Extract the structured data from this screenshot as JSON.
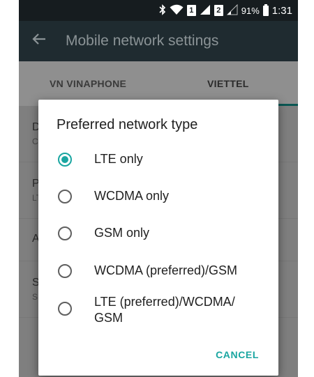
{
  "status_bar": {
    "sim1": "1",
    "sim2": "2",
    "battery": "91%",
    "time": "1:31"
  },
  "app_bar": {
    "title": "Mobile network settings"
  },
  "tabs": [
    {
      "label": "VN VINAPHONE"
    },
    {
      "label": "VIETTEL"
    }
  ],
  "background_list": [
    {
      "initial": "D",
      "sub": "C"
    },
    {
      "initial": "P",
      "sub": "LT"
    },
    {
      "initial": "A",
      "sub": ""
    },
    {
      "initial": "S",
      "sub": "S"
    }
  ],
  "dialog": {
    "title": "Preferred network type",
    "options": [
      {
        "label": "LTE only",
        "selected": true
      },
      {
        "label": "WCDMA only",
        "selected": false
      },
      {
        "label": "GSM only",
        "selected": false
      },
      {
        "label": "WCDMA (preferred)/GSM",
        "selected": false
      },
      {
        "label": "LTE (preferred)/WCDMA/ GSM",
        "selected": false
      }
    ],
    "cancel_label": "CANCEL"
  },
  "colors": {
    "accent": "#1aa6a1",
    "app_bar": "#1f2b30",
    "status_bar": "#161c1f"
  }
}
